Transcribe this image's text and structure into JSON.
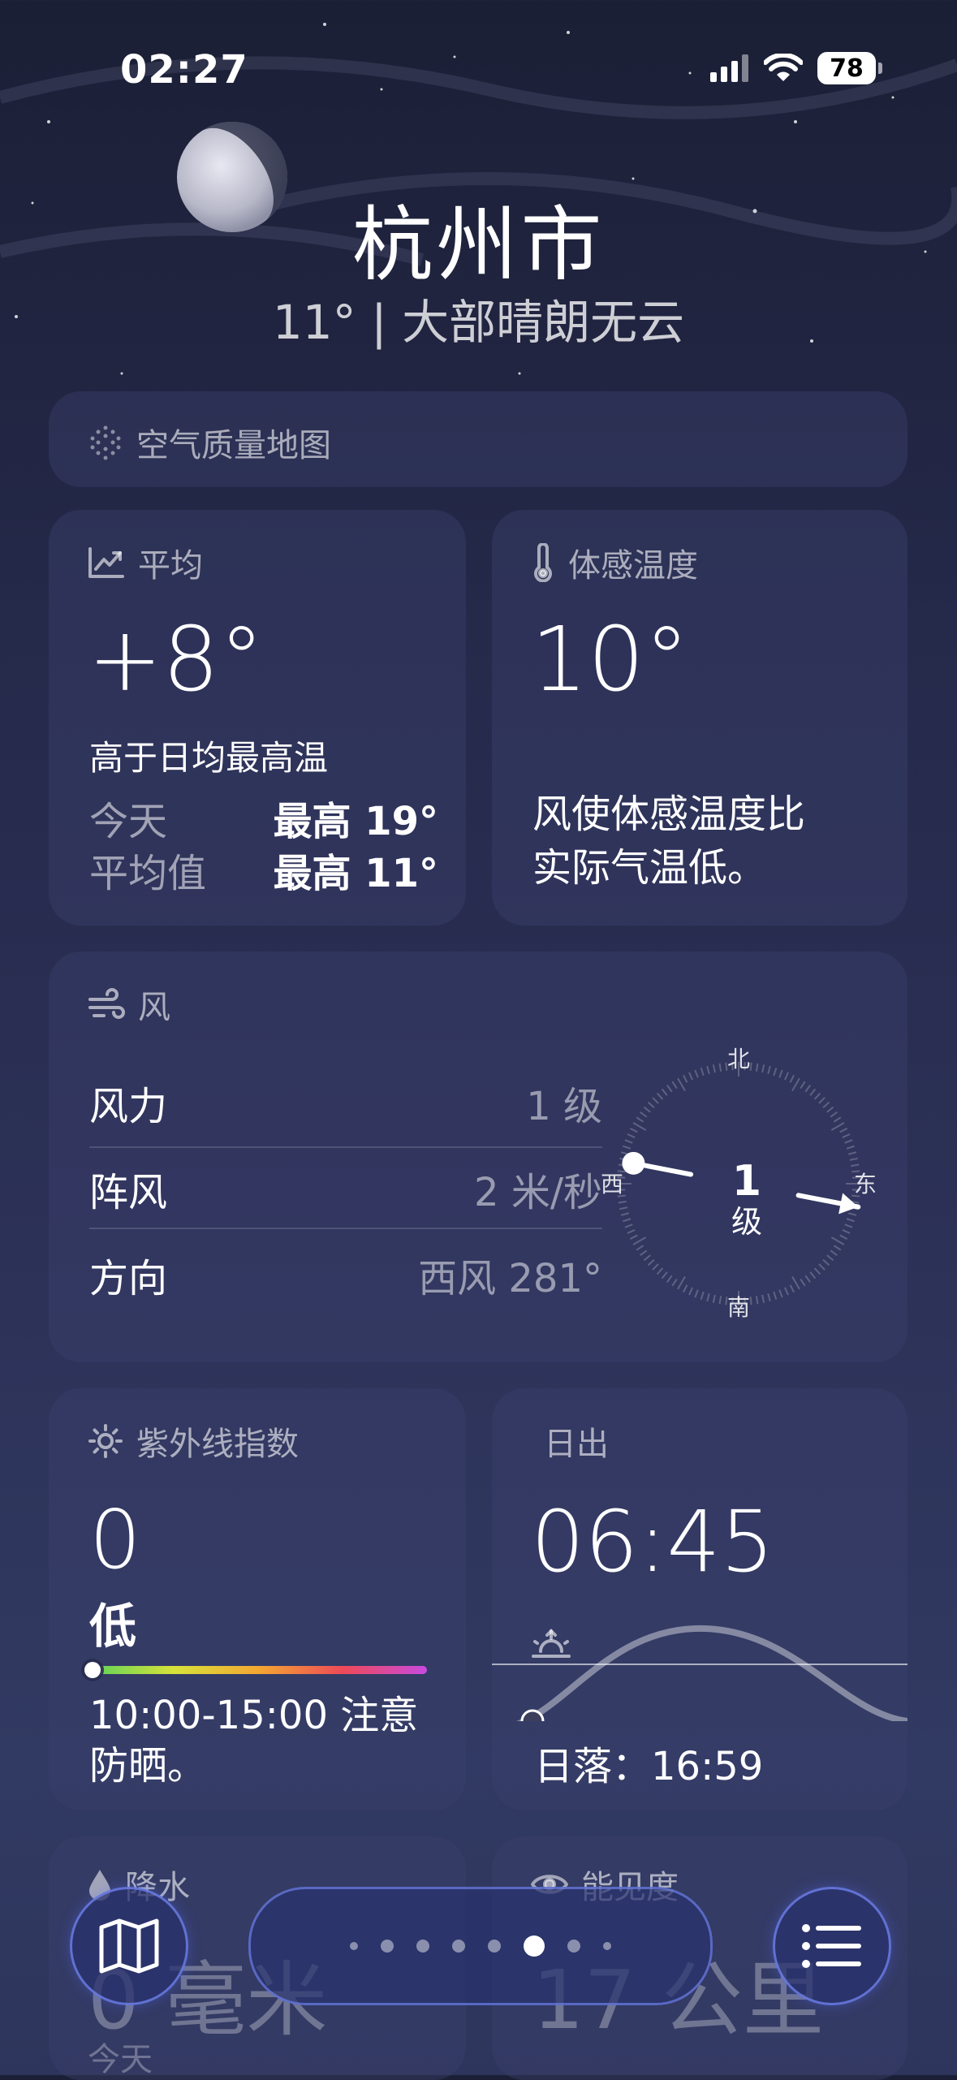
{
  "status_bar": {
    "time": "02:27",
    "battery": "78"
  },
  "header": {
    "city": "杭州市",
    "temp": "11°",
    "condition": "大部晴朗无云"
  },
  "air_quality": {
    "label": "空气质量地图"
  },
  "average": {
    "title": "平均",
    "value": "+8°",
    "desc": "高于日均最高温",
    "today_label": "今天",
    "today_value": "最高 19°",
    "avg_label": "平均值",
    "avg_value": "最高 11°"
  },
  "feels_like": {
    "title": "体感温度",
    "value": "10°",
    "note_line1": "风使体感温度比",
    "note_line2": "实际气温低。"
  },
  "wind": {
    "title": "风",
    "rows": [
      {
        "label": "风力",
        "value": "1 级"
      },
      {
        "label": "阵风",
        "value": "2 米/秒"
      },
      {
        "label": "方向",
        "value": "西风 281°"
      }
    ],
    "compass": {
      "n": "北",
      "s": "南",
      "e": "东",
      "w": "西",
      "center_value": "1",
      "center_unit": "级",
      "direction_deg": 281
    }
  },
  "uv": {
    "title": "紫外线指数",
    "value": "0",
    "level": "低",
    "index_fraction": 0,
    "tip_line1": "10:00-15:00 注意",
    "tip_line2": "防晒。"
  },
  "sunrise": {
    "title": "日出",
    "time": "06:45",
    "sunset": "日落：16:59"
  },
  "bottom_cards": {
    "precip_title": "降水",
    "precip_value": "0 毫米",
    "precip_sub": "今天",
    "visibility_title": "能见度",
    "visibility_value": "17 公里"
  },
  "pager": {
    "pages": 8,
    "current_index": 5
  },
  "colors": {
    "accent_ring": "#7f8cff"
  }
}
